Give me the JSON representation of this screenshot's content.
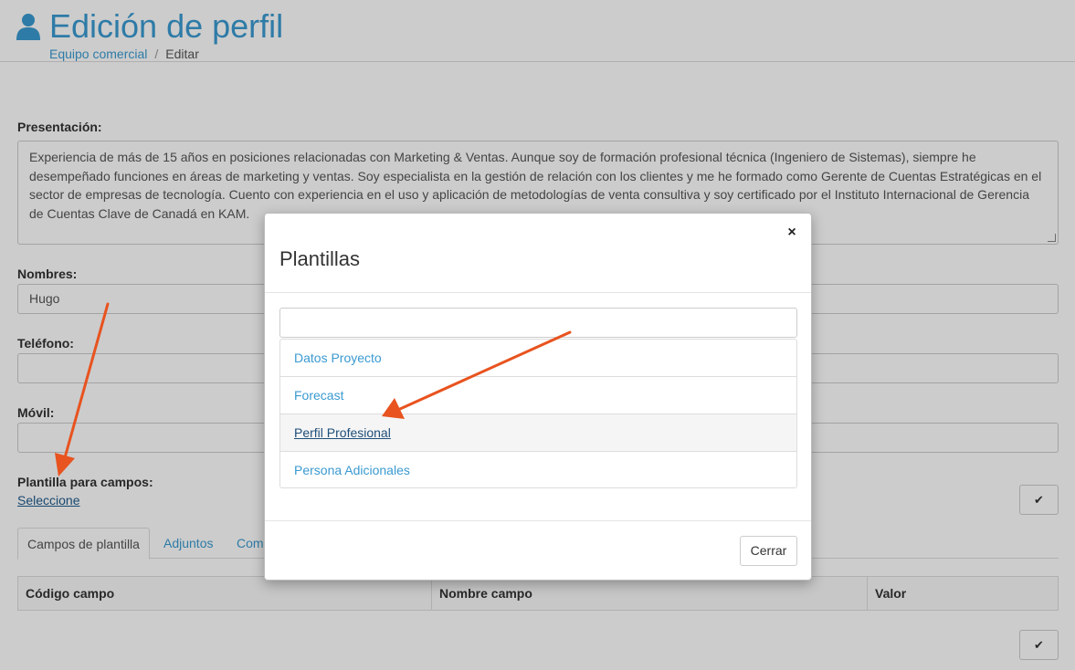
{
  "header": {
    "title": "Edición de perfil",
    "breadcrumb": {
      "parent": "Equipo comercial",
      "separator": "/",
      "current": "Editar"
    }
  },
  "form": {
    "presentacion_label": "Presentación:",
    "presentacion_value": "Experiencia de más de 15 años en posiciones relacionadas con Marketing & Ventas. Aunque soy de formación profesional técnica (Ingeniero de Sistemas), siempre he desempeñado funciones en áreas de marketing y ventas. Soy especialista en la gestión de relación con los clientes y me he formado como Gerente de Cuentas Estratégicas en el sector de empresas de tecnología. Cuento con experiencia en el uso y aplicación de metodologías de venta consultiva y soy certificado por el Instituto Internacional de Gerencia de Cuentas Clave de Canadá en KAM.",
    "nombres_label": "Nombres:",
    "nombres_value": "Hugo",
    "telefono_label": "Teléfono:",
    "telefono_value": "",
    "movil_label": "Móvil:",
    "movil_value": "",
    "plantilla_label": "Plantilla para campos:",
    "plantilla_link": "Seleccione",
    "check_icon": "✔"
  },
  "tabs": [
    {
      "label": "Campos de plantilla"
    },
    {
      "label": "Adjuntos"
    },
    {
      "label": "Come"
    }
  ],
  "table": {
    "columns": [
      "Código campo",
      "Nombre campo",
      "Valor"
    ]
  },
  "modal": {
    "title": "Plantillas",
    "close_glyph": "×",
    "search_value": "",
    "items": [
      "Datos Proyecto",
      "Forecast",
      "Perfil Profesional",
      "Persona Adicionales"
    ],
    "close_button": "Cerrar"
  },
  "colors": {
    "accent": "#3a9ad1",
    "annotation_arrow": "#e8531f"
  }
}
